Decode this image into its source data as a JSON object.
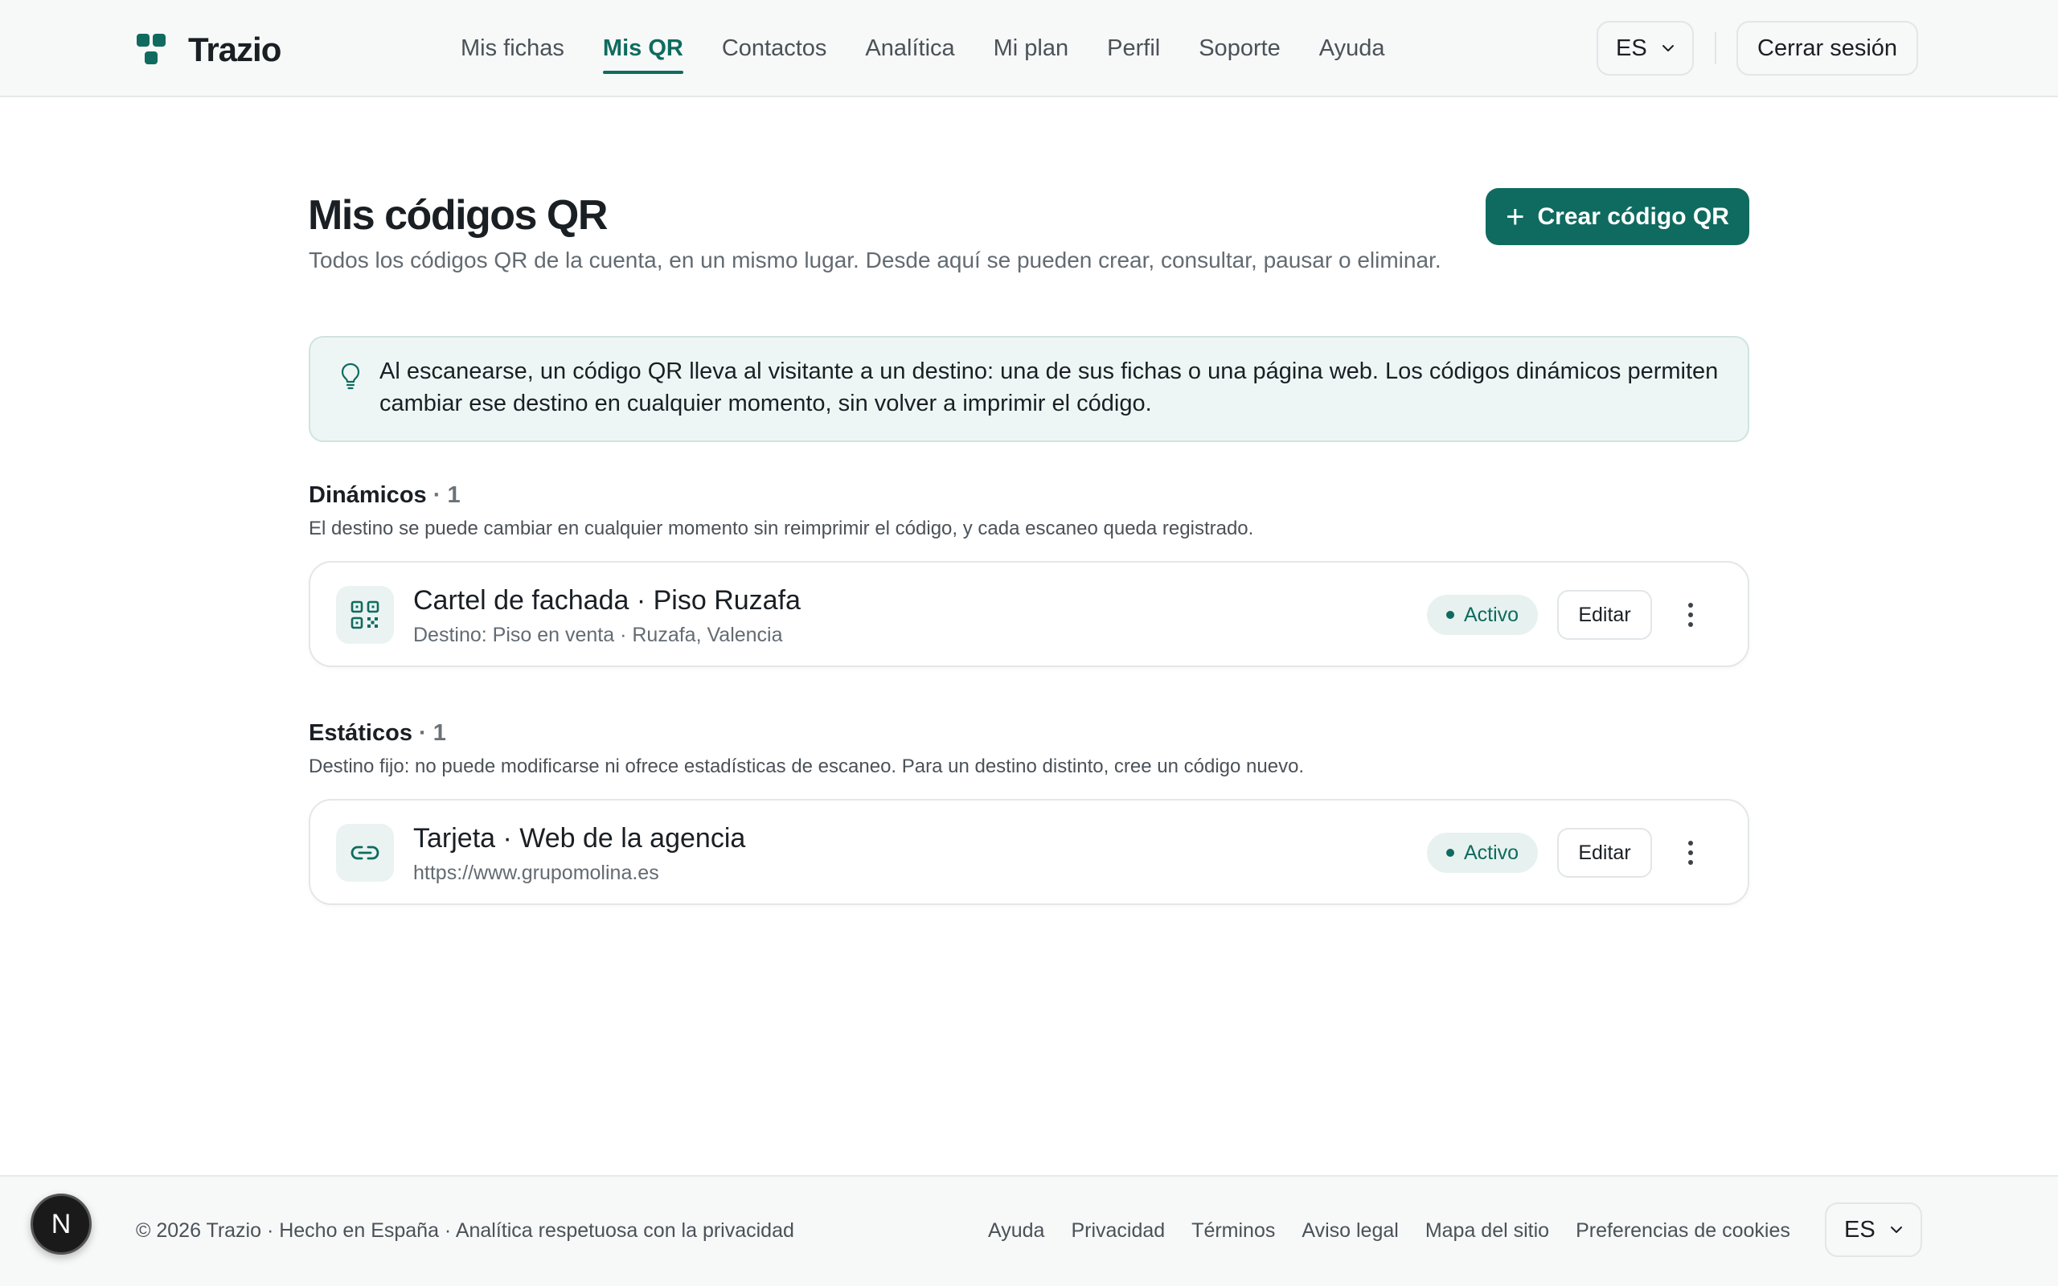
{
  "header": {
    "brand": "Trazio",
    "nav": [
      {
        "label": "Mis fichas",
        "active": false
      },
      {
        "label": "Mis QR",
        "active": true
      },
      {
        "label": "Contactos",
        "active": false
      },
      {
        "label": "Analítica",
        "active": false
      },
      {
        "label": "Mi plan",
        "active": false
      },
      {
        "label": "Perfil",
        "active": false
      },
      {
        "label": "Soporte",
        "active": false
      },
      {
        "label": "Ayuda",
        "active": false
      }
    ],
    "language": "ES",
    "logout_label": "Cerrar sesión"
  },
  "main": {
    "title": "Mis códigos QR",
    "subtitle": "Todos los códigos QR de la cuenta, en un mismo lugar. Desde aquí se pueden crear, consultar, pausar o eliminar.",
    "create_label": "Crear código QR",
    "info": "Al escanearse, un código QR lleva al visitante a un destino: una de sus fichas o una página web. Los códigos dinámicos permiten cambiar ese destino en cualquier momento, sin volver a imprimir el código.",
    "dynamic": {
      "heading": "Dinámicos",
      "count": "· 1",
      "description": "El destino se puede cambiar en cualquier momento sin reimprimir el código, y cada escaneo queda registrado.",
      "items": [
        {
          "name": "Cartel de fachada · Piso Ruzafa",
          "destination": "Destino: Piso en venta · Ruzafa, Valencia",
          "status": "Activo",
          "edit_label": "Editar",
          "icon": "qr-code-icon"
        }
      ]
    },
    "static": {
      "heading": "Estáticos",
      "count": "· 1",
      "description": "Destino fijo: no puede modificarse ni ofrece estadísticas de escaneo. Para un destino distinto, cree un código nuevo.",
      "items": [
        {
          "name": "Tarjeta · Web de la agencia",
          "destination": "https://www.grupomolina.es",
          "status": "Activo",
          "edit_label": "Editar",
          "icon": "link-icon"
        }
      ]
    }
  },
  "footer": {
    "copyright": "© 2026 Trazio · Hecho en España · Analítica respetuosa con la privacidad",
    "links": [
      "Ayuda",
      "Privacidad",
      "Términos",
      "Aviso legal",
      "Mapa del sitio",
      "Preferencias de cookies"
    ],
    "language": "ES"
  },
  "dev_badge": "N",
  "colors": {
    "accent": "#0f6b5f",
    "info_bg": "#eef6f5",
    "status_bg": "#e7f2f0"
  }
}
